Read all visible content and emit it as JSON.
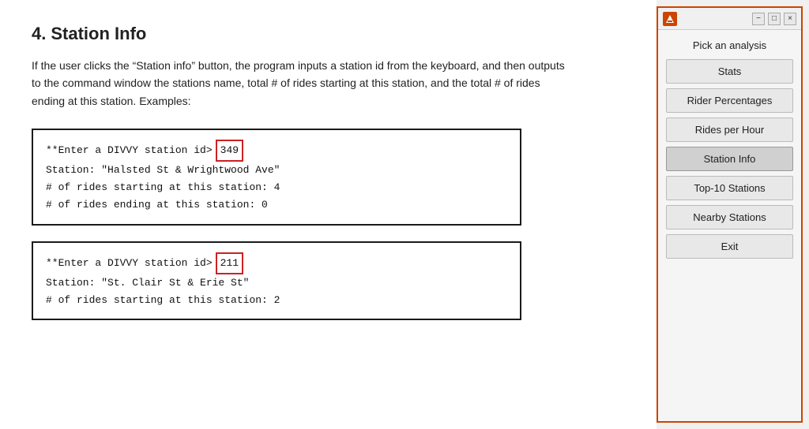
{
  "main": {
    "section_number": "4.",
    "section_title": "Station Info",
    "description": "If the user clicks the “Station info” button, the program inputs a station id from the keyboard, and then outputs to the command window the stations name, total # of rides starting at this station, and the total # of rides ending at this station.  Examples:",
    "code_block_1": {
      "prompt": "**Enter a DIVVY station id> ",
      "input_value": "349",
      "line2": "Station: \"Halsted St & Wrightwood Ave\"",
      "line3": "# of rides starting at this station: 4",
      "line4": "# of rides ending at this station:    0"
    },
    "code_block_2": {
      "prompt": "**Enter a DIVVY station id> ",
      "input_value": "211",
      "line2": "Station: \"St. Clair St & Erie St\"",
      "line3": "# of rides starting at this station: 2"
    }
  },
  "dialog": {
    "app_icon_label": "M",
    "minimize_label": "−",
    "maximize_label": "□",
    "close_label": "×",
    "header_label": "Pick an analysis",
    "buttons": [
      {
        "label": "Stats",
        "id": "stats-button"
      },
      {
        "label": "Rider Percentages",
        "id": "rider-percentages-button"
      },
      {
        "label": "Rides per Hour",
        "id": "rides-per-hour-button"
      },
      {
        "label": "Station Info",
        "id": "station-info-button"
      },
      {
        "label": "Top-10 Stations",
        "id": "top-10-stations-button"
      },
      {
        "label": "Nearby Stations",
        "id": "nearby-stations-button"
      },
      {
        "label": "Exit",
        "id": "exit-button"
      }
    ]
  }
}
